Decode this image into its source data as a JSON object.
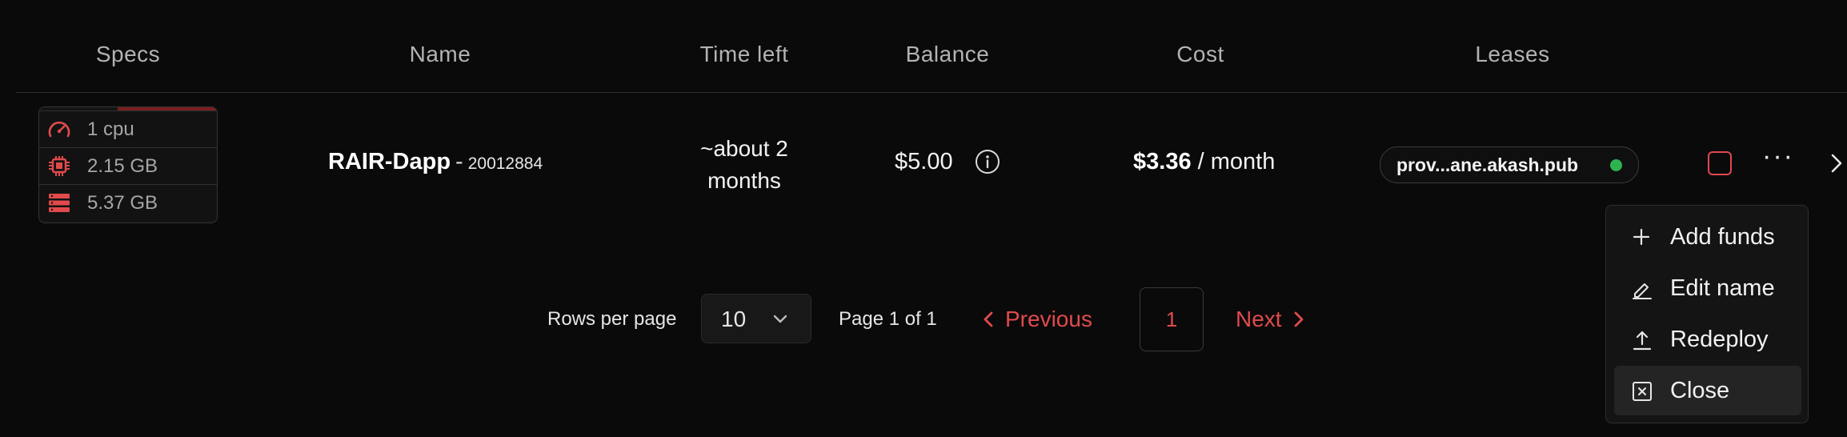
{
  "table": {
    "headers": [
      "Specs",
      "Name",
      "Time left",
      "Balance",
      "Cost",
      "Leases"
    ]
  },
  "row": {
    "specs": {
      "cpu": "1 cpu",
      "memory": "2.15 GB",
      "storage": "5.37 GB"
    },
    "name": "RAIR-Dapp",
    "name_separator": "-",
    "dseq": "20012884",
    "time_left": "~about 2 months",
    "balance": "$5.00",
    "cost_amount": "$3.36",
    "cost_period": "/ month",
    "lease_provider": "prov...ane.akash.pub",
    "lease_status": "active",
    "more_label": "···"
  },
  "pagination": {
    "rows_per_page_label": "Rows per page",
    "rows_per_page_value": "10",
    "page_info": "Page 1 of 1",
    "previous_label": "Previous",
    "current_page": "1",
    "next_label": "Next"
  },
  "context_menu": {
    "items": [
      {
        "label": "Add funds",
        "icon": "plus-icon"
      },
      {
        "label": "Edit name",
        "icon": "pencil-icon"
      },
      {
        "label": "Redeploy",
        "icon": "upload-icon"
      },
      {
        "label": "Close",
        "icon": "close-square-icon",
        "highlighted": true
      }
    ]
  },
  "colors": {
    "background": "#0b0a0a",
    "accent": "#e04a4c",
    "status_green": "#2fb34f"
  }
}
